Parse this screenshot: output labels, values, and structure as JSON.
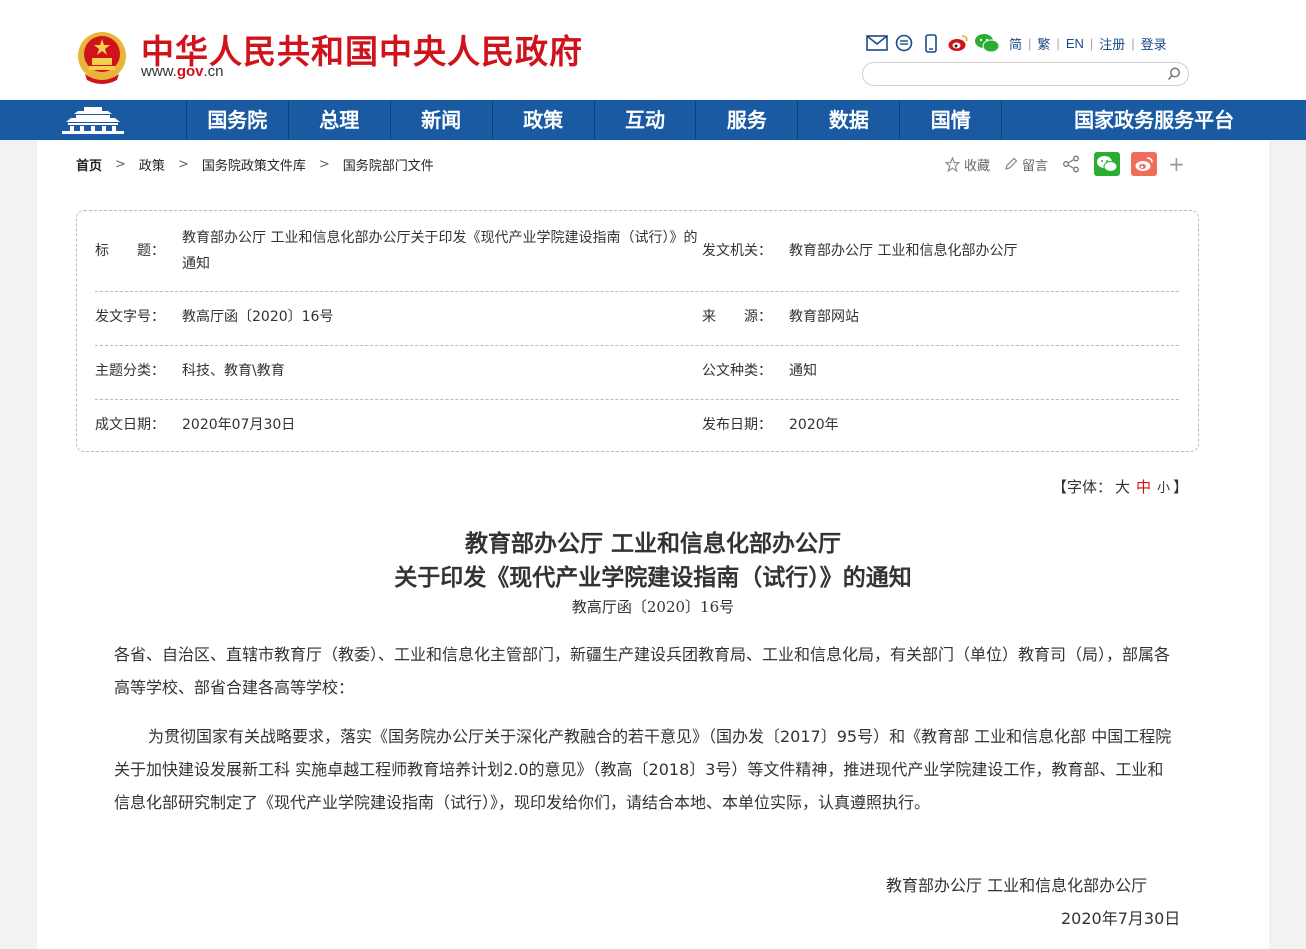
{
  "header": {
    "site_title": "中华人民共和国中央人民政府",
    "url_prefix": "www.",
    "url_gov": "gov",
    "url_suffix": ".cn",
    "lang_links": [
      "简",
      "繁",
      "EN",
      "注册",
      "登录"
    ],
    "search_placeholder": ""
  },
  "nav": {
    "items": [
      "国务院",
      "总理",
      "新闻",
      "政策",
      "互动",
      "服务",
      "数据",
      "国情",
      "国家政务服务平台"
    ]
  },
  "breadcrumb": [
    "首页",
    "政策",
    "国务院政策文件库",
    "国务院部门文件"
  ],
  "share": {
    "favorite_label": "收藏",
    "comment_label": "留言",
    "plus": "+"
  },
  "info": {
    "title_label": "标　　题：",
    "title_value": "教育部办公厅 工业和信息化部办公厅关于印发《现代产业学院建设指南（试行）》的通知",
    "issuer_label": "发文机关：",
    "issuer_value": "教育部办公厅 工业和信息化部办公厅",
    "docno_label": "发文字号：",
    "docno_value": "教高厅函〔2020〕16号",
    "source_label": "来　　源：",
    "source_value": "教育部网站",
    "topic_label": "主题分类：",
    "topic_value": "科技、教育\\教育",
    "type_label": "公文种类：",
    "type_value": "通知",
    "written_label": "成文日期：",
    "written_value": "2020年07月30日",
    "published_label": "发布日期：",
    "published_value": "2020年"
  },
  "fontsize": {
    "prefix": "【字体：",
    "large": "大",
    "medium": "中",
    "small": "小",
    "suffix": "】"
  },
  "article": {
    "title_line1": "教育部办公厅 工业和信息化部办公厅",
    "title_line2": "关于印发《现代产业学院建设指南（试行）》的通知",
    "doc_no": "教高厅函〔2020〕16号",
    "salutation": "各省、自治区、直辖市教育厅（教委）、工业和信息化主管部门，新疆生产建设兵团教育局、工业和信息化局，有关部门（单位）教育司（局），部属各高等学校、部省合建各高等学校：",
    "body": "为贯彻国家有关战略要求，落实《国务院办公厅关于深化产教融合的若干意见》（国办发〔2017〕95号）和《教育部 工业和信息化部 中国工程院关于加快建设发展新工科 实施卓越工程师教育培养计划2.0的意见》（教高〔2018〕3号）等文件精神，推进现代产业学院建设工作，教育部、工业和信息化部研究制定了《现代产业学院建设指南（试行）》，现印发给你们，请结合本地、本单位实际，认真遵照执行。",
    "signature": "教育部办公厅 工业和信息化部办公厅",
    "date": "2020年7月30日"
  }
}
